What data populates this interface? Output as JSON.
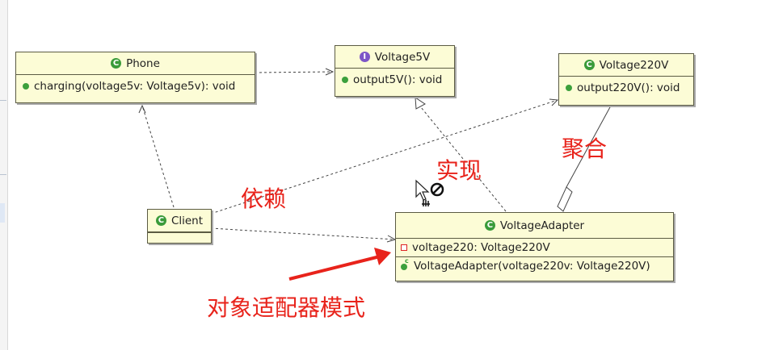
{
  "classes": {
    "phone": {
      "name": "Phone",
      "methods": [
        "charging(voltage5v: Voltage5v): void"
      ]
    },
    "voltage5v": {
      "name": "Voltage5V",
      "methods": [
        "output5V(): void"
      ]
    },
    "voltage220v": {
      "name": "Voltage220V",
      "methods": [
        "output220V(): void"
      ]
    },
    "client": {
      "name": "Client"
    },
    "adapter": {
      "name": "VoltageAdapter",
      "fields": [
        "voltage220: Voltage220V"
      ],
      "methods": [
        "VoltageAdapter(voltage220v: Voltage220V)"
      ]
    }
  },
  "annotations": {
    "dependency": "依赖",
    "realization": "实现",
    "aggregation": "聚合",
    "pattern": "对象适配器模式"
  },
  "colors": {
    "annotation": "#e8231b",
    "class_fill": "#fcfcd6",
    "class_border": "#5b5b43",
    "class_badge": "#3a9b3a",
    "interface_badge": "#7d56c7",
    "method_dot": "#3ca03c"
  },
  "icons": {
    "class": "class-badge-icon",
    "interface": "interface-badge-icon",
    "method": "public-method-icon",
    "field": "private-field-icon",
    "constructor": "constructor-icon",
    "cursor": "drag-cursor-icon",
    "no_drop": "no-drop-icon"
  }
}
